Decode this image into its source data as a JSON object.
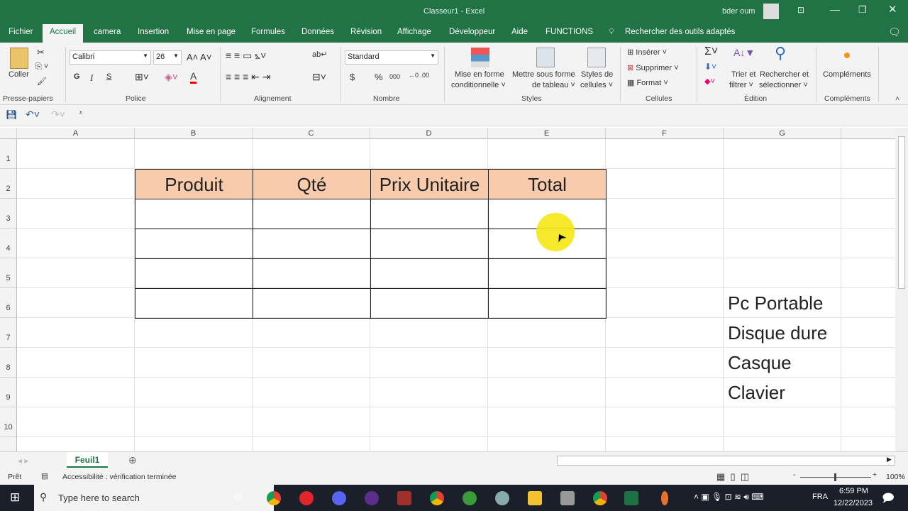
{
  "title": "Classeur1  -  Excel",
  "user": "bder oum",
  "tabs": [
    "Fichier",
    "Accueil",
    "camera",
    "Insertion",
    "Mise en page",
    "Formules",
    "Données",
    "Révision",
    "Affichage",
    "Développeur",
    "Aide",
    "FUNCTIONS"
  ],
  "tell_me": "Rechercher des outils adaptés",
  "ribbon": {
    "paste": "Coller",
    "font_name": "Calibri",
    "font_size": "26",
    "bold": "G",
    "italic": "I",
    "underline": "S",
    "number_format": "Standard",
    "currency": "$",
    "percent": "%",
    "thousands": "000",
    "cond_format": "Mise en forme",
    "cond_format2": "conditionnelle ˅",
    "as_table": "Mettre sous forme",
    "as_table2": "de tableau ˅",
    "cell_styles": "Styles de",
    "cell_styles2": "cellules ˅",
    "insert": "Insérer ˅",
    "delete": "Supprimer ˅",
    "format": "Format ˅",
    "sort": "Trier et",
    "sort2": "filtrer ˅",
    "find": "Rechercher et",
    "find2": "sélectionner ˅",
    "addins": "Compléments",
    "groups": [
      "Presse-papiers",
      "Police",
      "Alignement",
      "Nombre",
      "Styles",
      "Cellules",
      "Édition",
      "Compléments"
    ]
  },
  "columns": [
    "A",
    "B",
    "C",
    "D",
    "E",
    "F",
    "G"
  ],
  "rows": [
    "1",
    "2",
    "3",
    "4",
    "5",
    "6",
    "7",
    "8",
    "9",
    "10"
  ],
  "table_headers": [
    "Produit",
    "Qté",
    "Prix Unitaire",
    "Total"
  ],
  "list_items": [
    "Pc Portable",
    "Disque dure",
    "Casque",
    "Clavier"
  ],
  "sheet_tab": "Feuil1",
  "status": {
    "ready": "Prêt",
    "accessibility": "Accessibilité : vérification terminée",
    "zoom": "100%"
  },
  "taskbar": {
    "search": "Type here to search",
    "lang": "FRA",
    "time": "6:59 PM",
    "date": "12/22/2023"
  },
  "colors": {
    "accent": "#217346",
    "header_fill": "#f8cbad"
  }
}
